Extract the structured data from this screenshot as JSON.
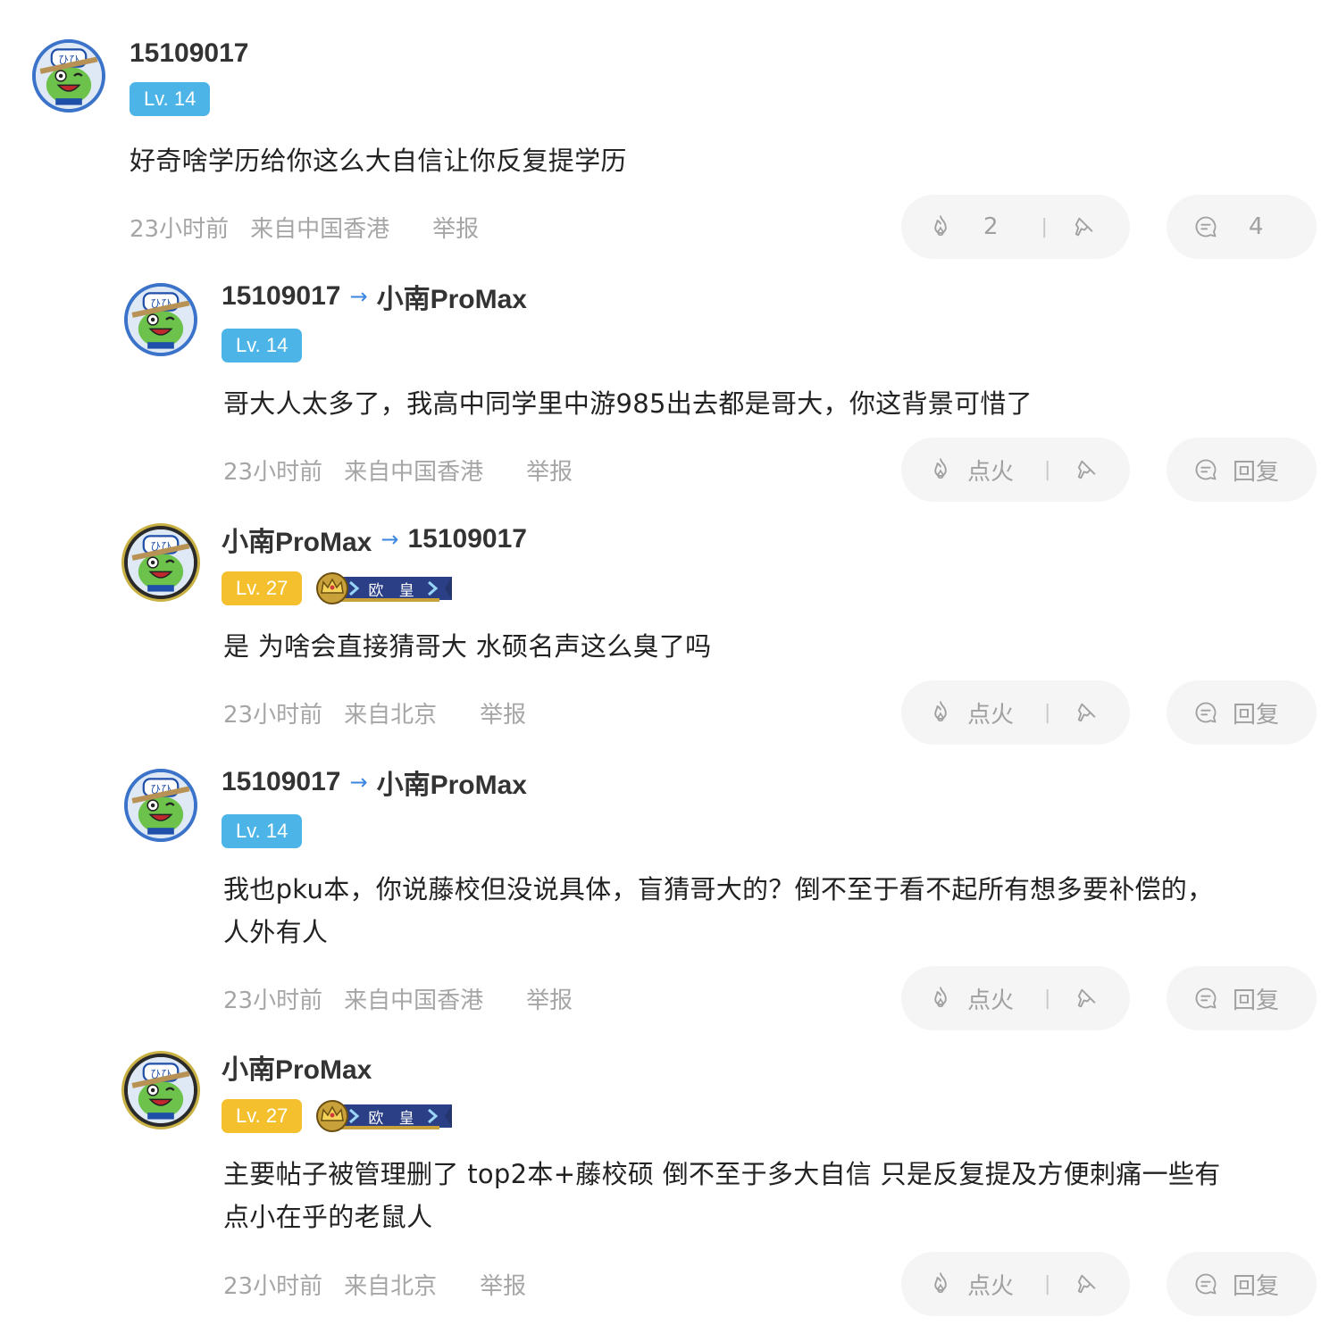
{
  "comments": [
    {
      "user": "15109017",
      "level": "Lv. 14",
      "text": "好奇啥学历给你这么大自信让你反复提学历",
      "time": "23小时前",
      "location": "来自中国香港",
      "report": "举报",
      "fire_label": "2",
      "reply_label": "4"
    },
    {
      "user": "15109017",
      "reply_to": "小南ProMax",
      "level": "Lv. 14",
      "text": "哥大人太多了，我高中同学里中游985出去都是哥大，你这背景可惜了",
      "time": "23小时前",
      "location": "来自中国香港",
      "report": "举报",
      "fire_label": "点火",
      "reply_label": "回复"
    },
    {
      "user": "小南ProMax",
      "reply_to": "15109017",
      "level": "Lv. 27",
      "medal": "欧 皇",
      "text": "是 为啥会直接猜哥大 水硕名声这么臭了吗",
      "time": "23小时前",
      "location": "来自北京",
      "report": "举报",
      "fire_label": "点火",
      "reply_label": "回复"
    },
    {
      "user": "15109017",
      "reply_to": "小南ProMax",
      "level": "Lv. 14",
      "text_line1": "我也pku本，你说藤校但没说具体，盲猜哥大的？倒不至于看不起所有想多要补偿的，",
      "text_line2": "人外有人",
      "time": "23小时前",
      "location": "来自中国香港",
      "report": "举报",
      "fire_label": "点火",
      "reply_label": "回复"
    },
    {
      "user": "小南ProMax",
      "level": "Lv. 27",
      "medal": "欧 皇",
      "text_line1": "主要帖子被管理删了 top2本+藤校硕 倒不至于多大自信 只是反复提及方便刺痛一些有",
      "text_line2": "点小在乎的老鼠人",
      "time": "23小时前",
      "location": "来自北京",
      "report": "举报",
      "fire_label": "点火",
      "reply_label": "回复"
    }
  ],
  "reply_arrow": "→",
  "colors": {
    "level_blue": "#4cb4e7",
    "level_gold": "#f5c02e",
    "arrow_blue": "#3a86e0",
    "meta_gray": "#a6a6a6",
    "pill_bg": "#f5f5f5"
  },
  "icons": [
    "frog-avatar",
    "fire-icon",
    "dislike-icon",
    "comment-icon",
    "crown-medal"
  ]
}
